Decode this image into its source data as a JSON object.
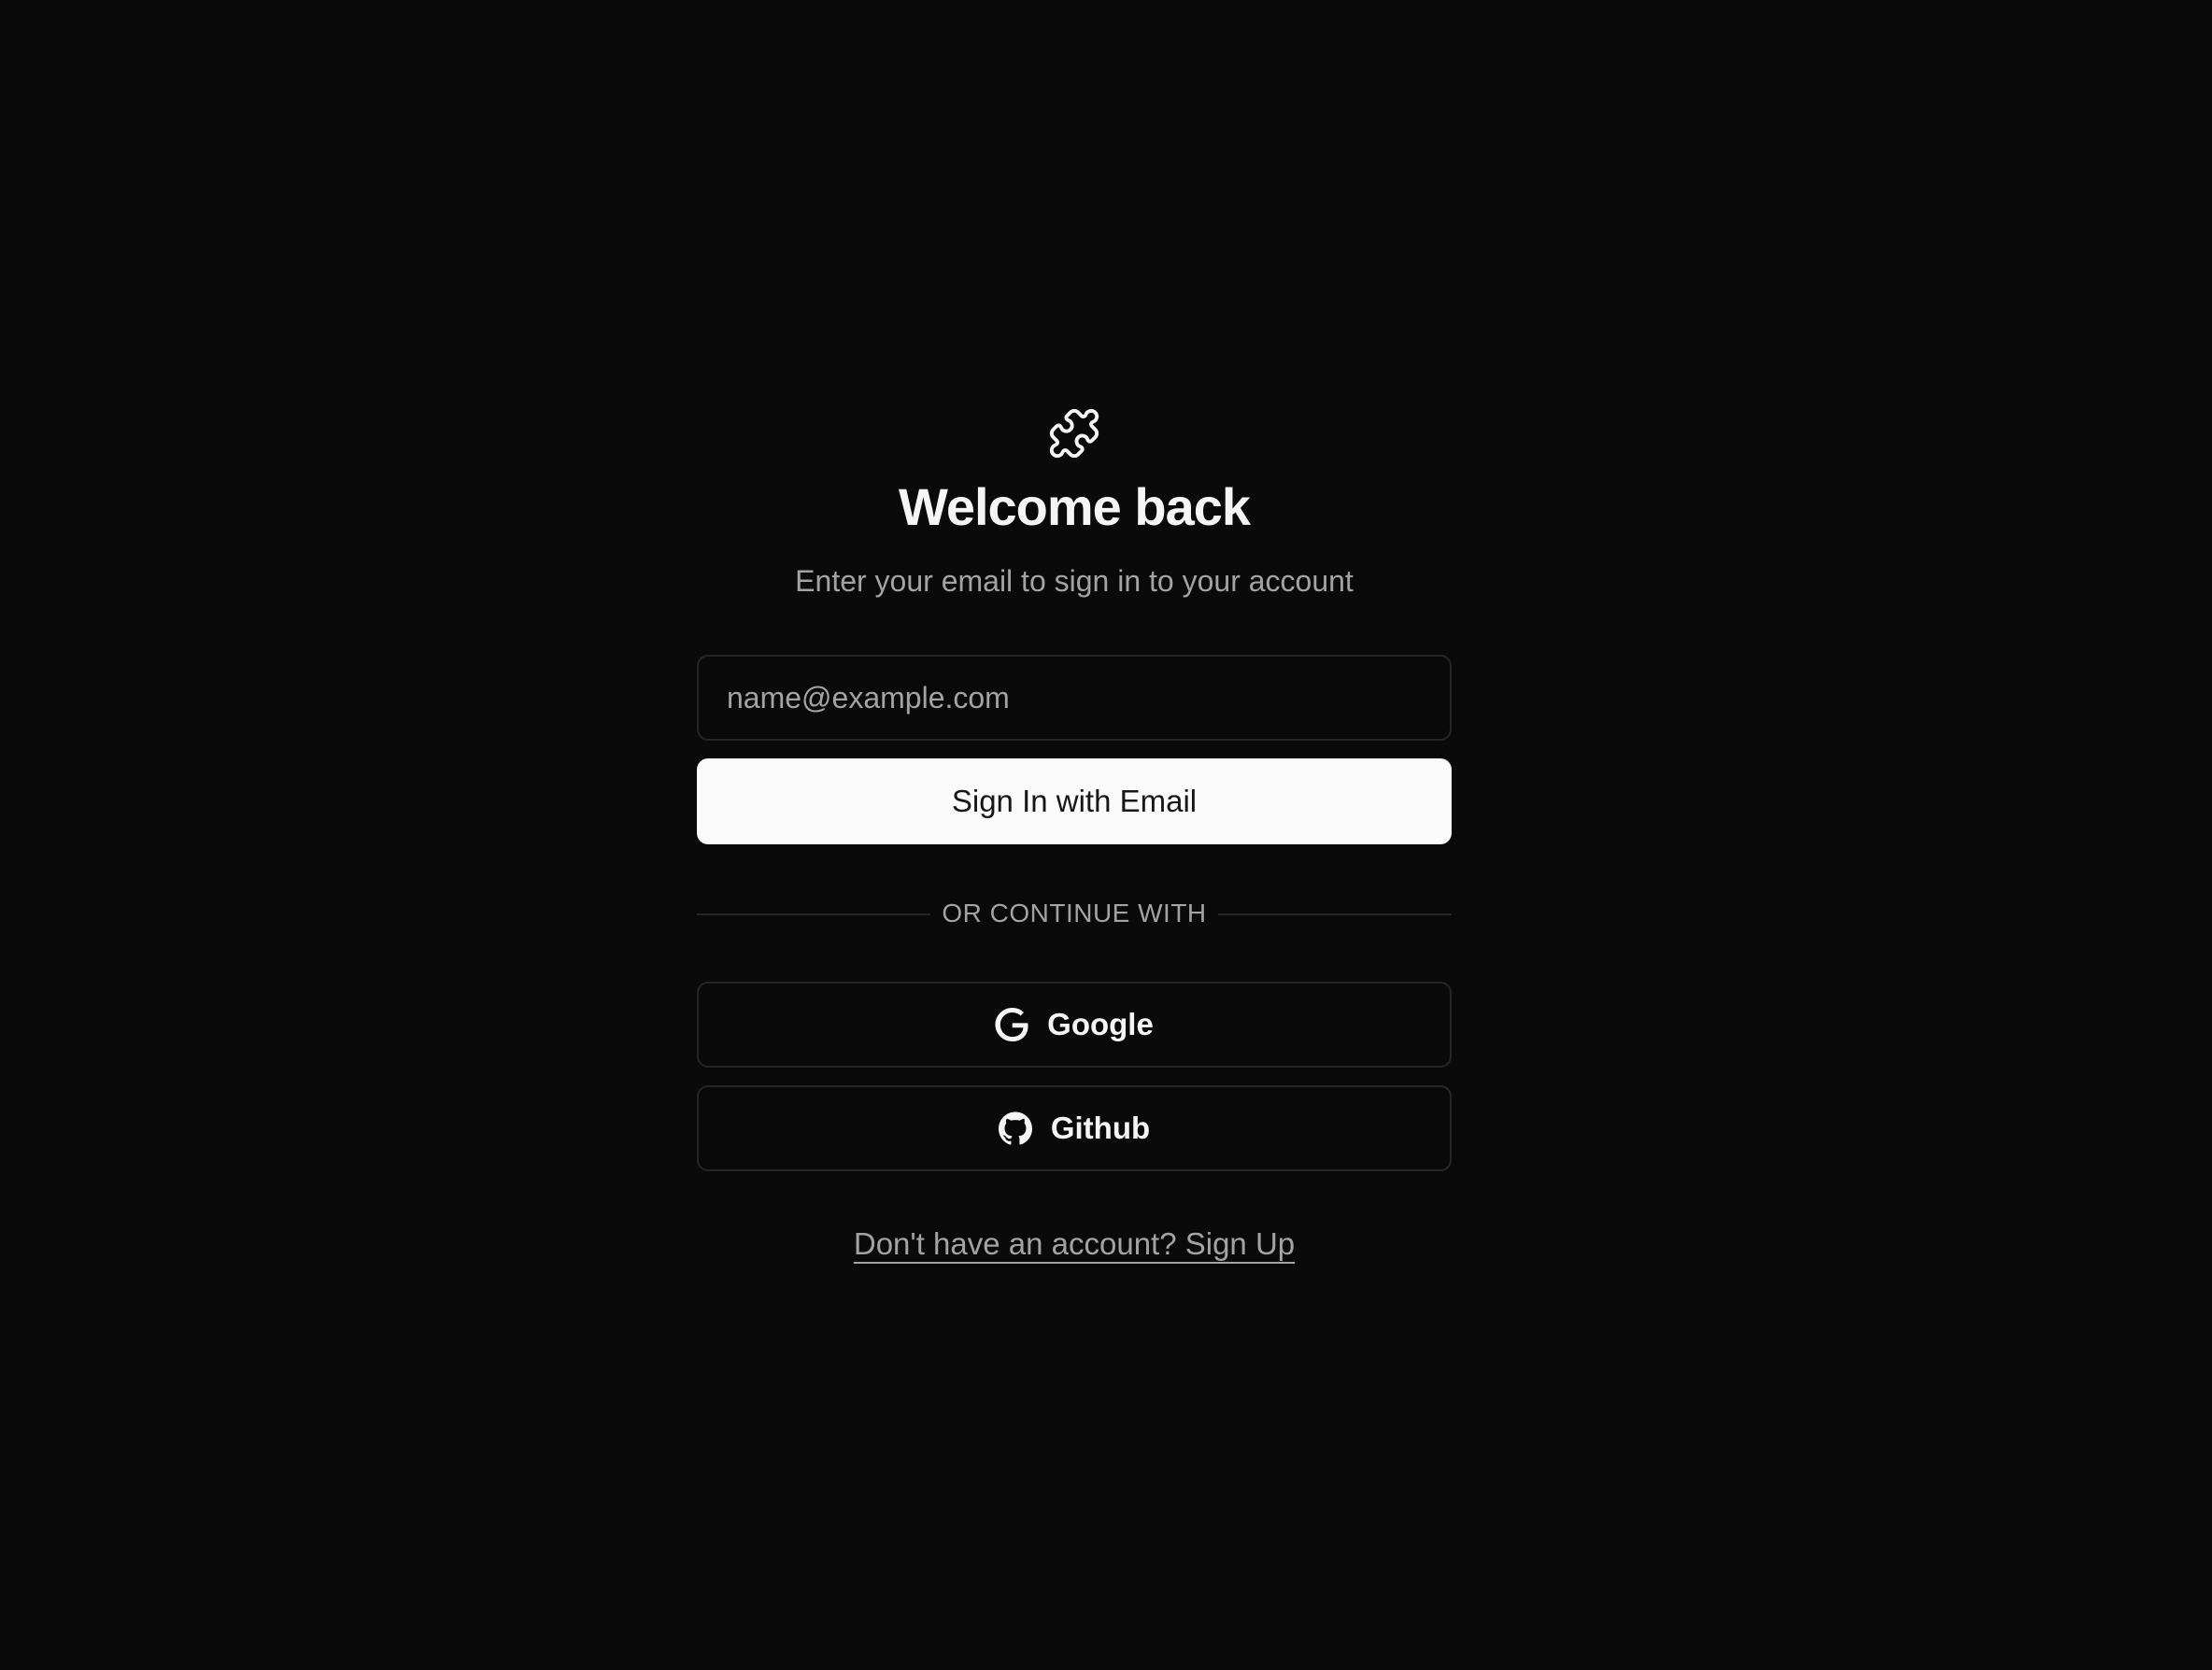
{
  "logo": {
    "icon": "puzzle-icon"
  },
  "header": {
    "title": "Welcome back",
    "subtitle": "Enter your email to sign in to your account"
  },
  "email": {
    "placeholder": "name@example.com",
    "value": ""
  },
  "primary_button": {
    "label": "Sign In with Email"
  },
  "divider": {
    "label": "OR CONTINUE WITH"
  },
  "oauth": [
    {
      "label": "Google",
      "icon": "google-icon"
    },
    {
      "label": "Github",
      "icon": "github-icon"
    }
  ],
  "footer": {
    "signup_link": "Don't have an account? Sign Up"
  },
  "colors": {
    "background": "#0a0a0a",
    "border": "#262626",
    "muted_text": "#a3a3a3",
    "primary_bg": "#fafafa",
    "primary_text": "#171717"
  }
}
